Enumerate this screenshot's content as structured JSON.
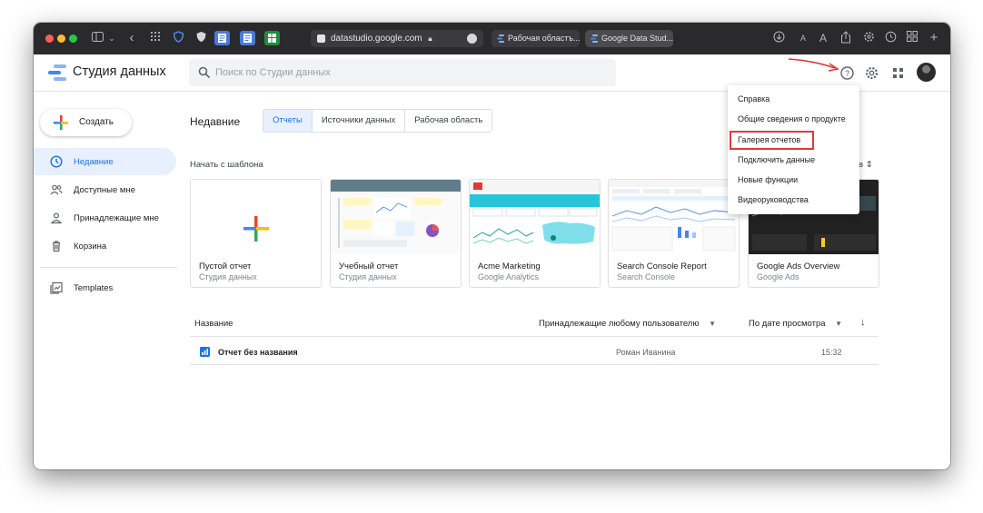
{
  "browser": {
    "address": "datastudio.google.com",
    "tabs": [
      "Рабочая областъ...",
      "Google Data Stud..."
    ],
    "font_small": "A",
    "font_large": "A"
  },
  "app": {
    "title": "Студия данных",
    "search_placeholder": "Поиск по Студии данных"
  },
  "sidebar": {
    "create_label": "Создать",
    "items": [
      {
        "label": "Недавние",
        "icon": "clock-icon",
        "active": true
      },
      {
        "label": "Доступные мне",
        "icon": "people-icon",
        "active": false
      },
      {
        "label": "Принадлежащие мне",
        "icon": "person-icon",
        "active": false
      },
      {
        "label": "Корзина",
        "icon": "trash-icon",
        "active": false
      },
      {
        "label": "Templates",
        "icon": "templates-icon",
        "active": false
      }
    ]
  },
  "main": {
    "section_title": "Недавние",
    "tabs": [
      "Отчеты",
      "Источники данных",
      "Рабочая область"
    ],
    "templates_title": "Начать с шаблона",
    "templates_toggle": "в",
    "templates": [
      {
        "name": "Пустой отчет",
        "source": "Студия данных"
      },
      {
        "name": "Учебный отчет",
        "source": "Студия данных"
      },
      {
        "name": "Acme Marketing",
        "source": "Google Analytics"
      },
      {
        "name": "Search Console Report",
        "source": "Search Console"
      },
      {
        "name": "Google Ads Overview",
        "source": "Google Ads"
      }
    ],
    "table": {
      "col_name": "Название",
      "owner_filter": "Принадлежащие любому пользователю",
      "sort_label": "По дате просмотра",
      "rows": [
        {
          "name": "Отчет без названия",
          "owner": "Роман Иванина",
          "time": "15:32"
        }
      ]
    }
  },
  "help_menu": {
    "items": [
      "Справка",
      "Общие сведения о продукте",
      "Галерея отчетов",
      "Подключить данные",
      "Новые функции",
      "Видеоруководства"
    ],
    "highlighted": "Галерея отчетов"
  },
  "colors": {
    "accent": "#1a73e8",
    "highlight": "#e53935",
    "toolbar": "#2a2a2d"
  }
}
